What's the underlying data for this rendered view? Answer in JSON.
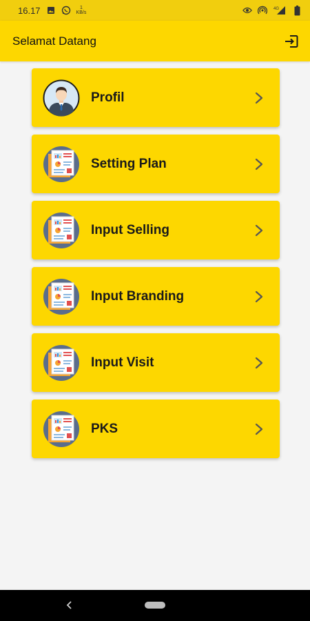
{
  "status_bar": {
    "time": "16.17",
    "network_speed_value": "1",
    "network_speed_unit": "KB/s",
    "signal_label": "4G",
    "icons": [
      "image-icon",
      "whatsapp-icon",
      "eye-icon",
      "hotspot-icon",
      "signal-icon",
      "battery-icon"
    ]
  },
  "app_bar": {
    "title": "Selamat Datang",
    "logout_icon": "logout-icon"
  },
  "menu": {
    "items": [
      {
        "label": "Profil",
        "icon": "profile-avatar-icon"
      },
      {
        "label": "Setting Plan",
        "icon": "report-icon"
      },
      {
        "label": "Input Selling",
        "icon": "report-icon"
      },
      {
        "label": "Input Branding",
        "icon": "report-icon"
      },
      {
        "label": "Input Visit",
        "icon": "report-icon"
      },
      {
        "label": "PKS",
        "icon": "report-icon"
      }
    ]
  },
  "nav_bar": {
    "icons": [
      "back-icon",
      "home-pill-icon"
    ]
  },
  "colors": {
    "primary": "#fdd700",
    "status_bar": "#f1ce0e",
    "background": "#f4f4f4",
    "nav_bar": "#000000"
  }
}
